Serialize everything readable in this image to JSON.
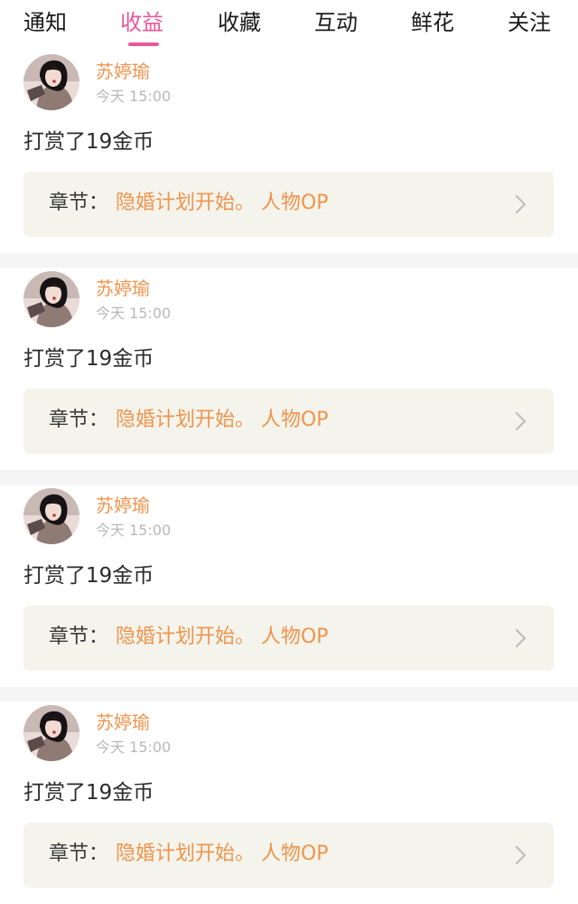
{
  "tabs": [
    {
      "label": "通知",
      "active": false
    },
    {
      "label": "收益",
      "active": true
    },
    {
      "label": "收藏",
      "active": false
    },
    {
      "label": "互动",
      "active": false
    },
    {
      "label": "鲜花",
      "active": false
    },
    {
      "label": "关注",
      "active": false
    }
  ],
  "accent_color": "#e8589a",
  "name_color": "#f0934c",
  "feed": [
    {
      "username": "苏婷瑜",
      "time": "今天 15:00",
      "message": "打赏了19金币",
      "chapter_label": "章节：",
      "chapter_title": "隐婚计划开始。 人物OP",
      "avatar_icon": "user-avatar"
    },
    {
      "username": "苏婷瑜",
      "time": "今天 15:00",
      "message": "打赏了19金币",
      "chapter_label": "章节：",
      "chapter_title": "隐婚计划开始。 人物OP",
      "avatar_icon": "user-avatar"
    },
    {
      "username": "苏婷瑜",
      "time": "今天 15:00",
      "message": "打赏了19金币",
      "chapter_label": "章节：",
      "chapter_title": "隐婚计划开始。 人物OP",
      "avatar_icon": "user-avatar"
    },
    {
      "username": "苏婷瑜",
      "time": "今天 15:00",
      "message": "打赏了19金币",
      "chapter_label": "章节：",
      "chapter_title": "隐婚计划开始。 人物OP",
      "avatar_icon": "user-avatar"
    }
  ]
}
